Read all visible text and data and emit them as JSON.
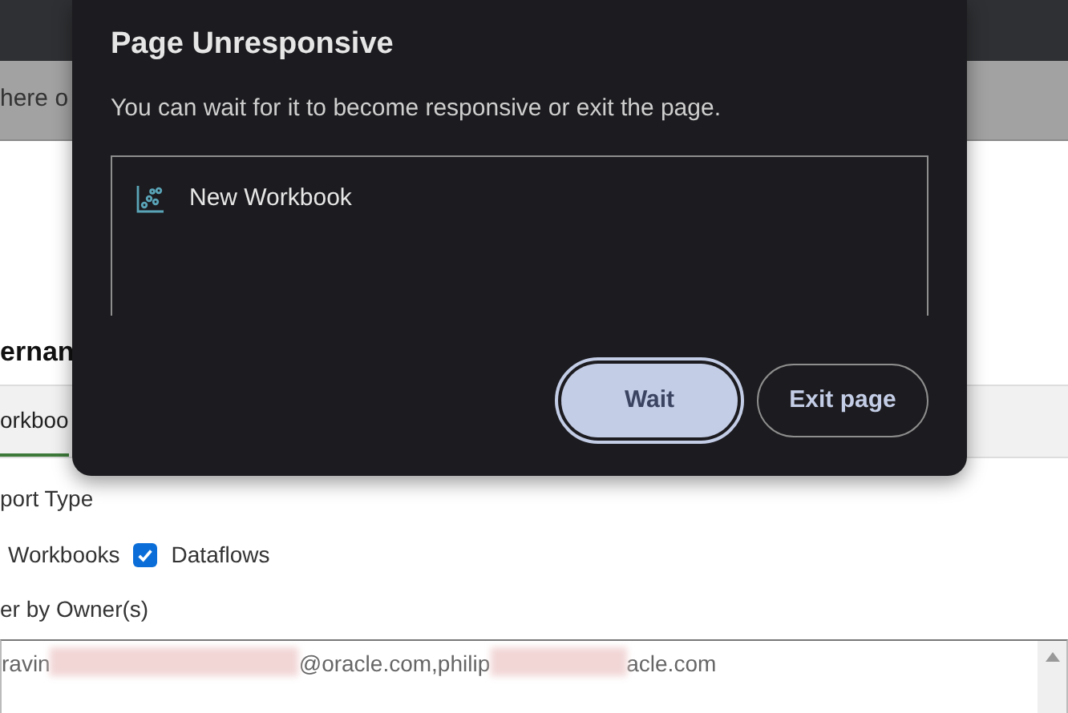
{
  "background_page": {
    "banner_text": "here o",
    "heading": "ernan",
    "tab": {
      "label": "orkboo",
      "selected": true
    },
    "export_type_label": "port Type",
    "checkboxes": [
      {
        "kind": "label",
        "label": "Workbooks"
      },
      {
        "kind": "checkbox",
        "label": "Dataflows",
        "checked": true
      }
    ],
    "owner_filter_label": "er by Owner(s)",
    "owner_field_parts": [
      {
        "kind": "text",
        "text": "ravin"
      },
      {
        "kind": "redacted"
      },
      {
        "kind": "text",
        "text": "@oracle.com,philip"
      },
      {
        "kind": "redacted"
      },
      {
        "kind": "text",
        "text": "acle.com"
      }
    ]
  },
  "dialog": {
    "title": "Page Unresponsive",
    "message": "You can wait for it to become responsive or exit the page.",
    "pages": [
      {
        "label": "New Workbook"
      }
    ],
    "buttons": [
      {
        "label": "Wait",
        "kind": "primary"
      },
      {
        "label": "Exit page",
        "kind": "secondary"
      }
    ]
  }
}
